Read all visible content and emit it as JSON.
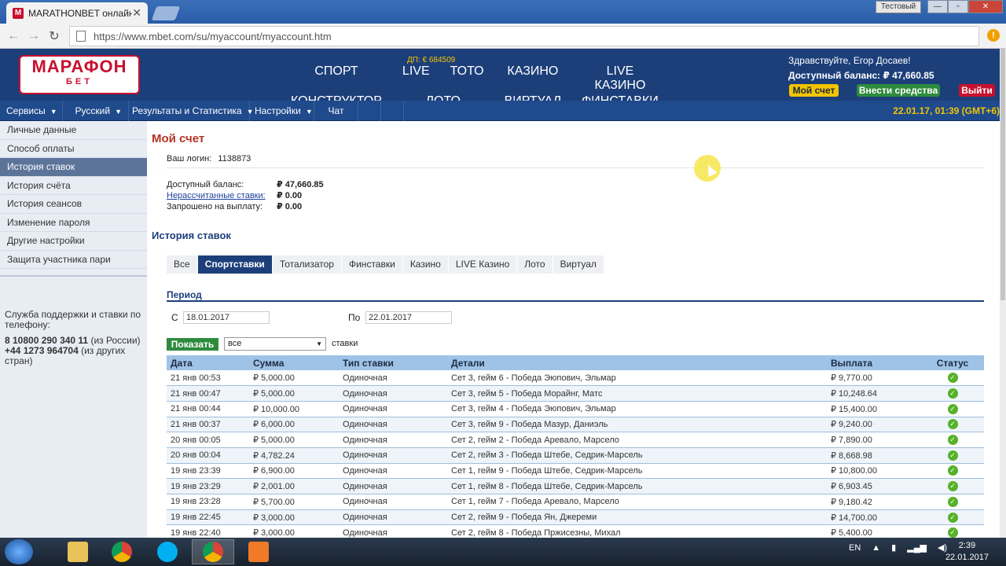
{
  "browser": {
    "tab_title": "MARATHONBET онлайн",
    "tab_favicon": "M",
    "tab_close": "✕",
    "profile": "Тестовый",
    "url": "https://www.mbet.com/su/myaccount/myaccount.htm",
    "alert": "!"
  },
  "header": {
    "logo_line1": "МАРАФОН",
    "logo_line2": "БЕТ",
    "dp": "ДП: € 684509",
    "nav": [
      "СПОРТ",
      "LIVE",
      "ТОТО",
      "КАЗИНО",
      "LIVE КАЗИНО",
      "КОНСТРУКТОР",
      "ЛОТО",
      "ВИРТУАЛ",
      "ФИНСТАВКИ"
    ],
    "greeting": "Здравствуйте, Егор Досаев!",
    "balance": "Доступный баланс: ₽ 47,660.85",
    "btn_account": "Мой счет",
    "btn_deposit": "Внести средства",
    "btn_logout": "Выйти",
    "colors": {
      "header_bg": "#1c3f7a",
      "accent_yellow": "#f2c500",
      "green": "#2e8b3e",
      "red": "#c8102e"
    }
  },
  "menu": {
    "services": "Сервисы",
    "language": "Русский",
    "results": "Результаты и Статистика",
    "settings": "Настройки",
    "chat": "Чат",
    "datetime": "22.01.17, 01:39 (GMT+6)"
  },
  "sidebar": {
    "items": [
      {
        "label": "Личные данные",
        "active": false
      },
      {
        "label": "Способ оплаты",
        "active": false
      },
      {
        "label": "История ставок",
        "active": true
      },
      {
        "label": "История счёта",
        "active": false
      },
      {
        "label": "История сеансов",
        "active": false
      },
      {
        "label": "Изменение пароля",
        "active": false
      },
      {
        "label": "Другие настройки",
        "active": false
      },
      {
        "label": "Защита участника пари",
        "active": false
      }
    ],
    "support_text": "Служба поддержки и ставки по телефону:",
    "phone1": "8 10800 290 340 11",
    "phone1_note": "(из России)",
    "phone2": "+44 1273 964704",
    "phone2_note": "(из других стран)"
  },
  "main": {
    "title": "Мой счет",
    "login_label": "Ваш логин:",
    "login_value": "1138873",
    "balance_label": "Доступный баланс:",
    "balance_value": "₽ 47,660.85",
    "unsettled_label": "Нерассчитанные ставки:",
    "unsettled_value": "₽ 0.00",
    "withdraw_label": "Запрошено на выплату:",
    "withdraw_value": "₽ 0.00",
    "history_title": "История ставок",
    "filter_tabs": [
      {
        "label": "Все",
        "active": false
      },
      {
        "label": "Спортставки",
        "active": true
      },
      {
        "label": "Тотализатор",
        "active": false
      },
      {
        "label": "Финставки",
        "active": false
      },
      {
        "label": "Казино",
        "active": false
      },
      {
        "label": "LIVE Казино",
        "active": false
      },
      {
        "label": "Лото",
        "active": false
      },
      {
        "label": "Виртуал",
        "active": false
      }
    ],
    "period_title": "Период",
    "from_label": "С",
    "from_value": "18.01.2017",
    "to_label": "По",
    "to_value": "22.01.2017",
    "show_button": "Показать",
    "select_value": "все",
    "select_suffix": "ставки",
    "columns": [
      "Дата",
      "Сумма",
      "Тип ставки",
      "Детали",
      "Выплата",
      "Статус"
    ],
    "rows": [
      [
        "21 янв 00:53",
        "₽ 5,000.00",
        "Одиночная",
        "Сет 3, гейм 6 - Победа Эюпович, Эльмар",
        "₽ 9,770.00"
      ],
      [
        "21 янв 00:47",
        "₽ 5,000.00",
        "Одиночная",
        "Сет 3, гейм 5 - Победа Морайнг, Матс",
        "₽ 10,248.64"
      ],
      [
        "21 янв 00:44",
        "₽ 10,000.00",
        "Одиночная",
        "Сет 3, гейм 4 - Победа Эюпович, Эльмар",
        "₽ 15,400.00"
      ],
      [
        "21 янв 00:37",
        "₽ 6,000.00",
        "Одиночная",
        "Сет 3, гейм 9 - Победа Мазур, Даниэль",
        "₽ 9,240.00"
      ],
      [
        "20 янв 00:05",
        "₽ 5,000.00",
        "Одиночная",
        "Сет 2, гейм 2 - Победа Аревало, Марсело",
        "₽ 7,890.00"
      ],
      [
        "20 янв 00:04",
        "₽ 4,782.24",
        "Одиночная",
        "Сет 2, гейм 3 - Победа Штебе, Седрик-Марсель",
        "₽ 8,668.98"
      ],
      [
        "19 янв 23:39",
        "₽ 6,900.00",
        "Одиночная",
        "Сет 1, гейм 9 - Победа Штебе, Седрик-Марсель",
        "₽ 10,800.00"
      ],
      [
        "19 янв 23:29",
        "₽ 2,001.00",
        "Одиночная",
        "Сет 1, гейм 8 - Победа Штебе, Седрик-Марсель",
        "₽ 6,903.45"
      ],
      [
        "19 янв 23:28",
        "₽ 5,700.00",
        "Одиночная",
        "Сет 1, гейм 7 - Победа Аревало, Марсело",
        "₽ 9,180.42"
      ],
      [
        "19 янв 22:45",
        "₽ 3,000.00",
        "Одиночная",
        "Сет 2, гейм 9 - Победа Ян, Джереми",
        "₽ 14,700.00"
      ],
      [
        "19 янв 22:40",
        "₽ 3,000.00",
        "Одиночная",
        "Сет 2, гейм 8 - Победа Пржисезны, Михал",
        "₽ 5,400.00"
      ]
    ],
    "status_icon": "check-circle-icon"
  },
  "taskbar": {
    "lang": "EN",
    "time": "2:39",
    "date": "22.01.2017"
  }
}
